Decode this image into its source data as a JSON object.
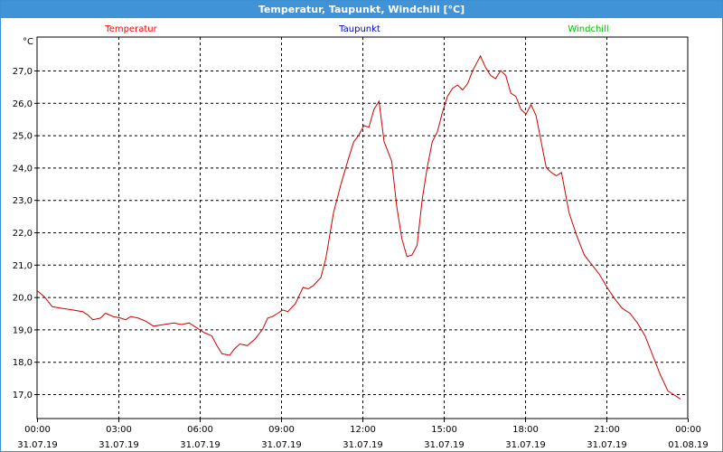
{
  "window": {
    "title": "Temperatur, Taupunkt, Windchill [°C]"
  },
  "chart_data": {
    "type": "line",
    "title": "Temperatur, Taupunkt, Windchill [°C]",
    "y_unit": "°C",
    "ylim": [
      16.6,
      28.0
    ],
    "xlim": [
      0,
      24
    ],
    "grid": true,
    "legend_placement": "top",
    "y_ticks": [
      {
        "value": 17,
        "label": "17,0"
      },
      {
        "value": 18,
        "label": "18,0"
      },
      {
        "value": 19,
        "label": "19,0"
      },
      {
        "value": 20,
        "label": "20,0"
      },
      {
        "value": 21,
        "label": "21,0"
      },
      {
        "value": 22,
        "label": "22,0"
      },
      {
        "value": 23,
        "label": "23,0"
      },
      {
        "value": 24,
        "label": "24,0"
      },
      {
        "value": 25,
        "label": "25,0"
      },
      {
        "value": 26,
        "label": "26,0"
      },
      {
        "value": 27,
        "label": "27,0"
      }
    ],
    "x_ticks": [
      {
        "hour": 0,
        "time": "00:00",
        "date": "31.07.19"
      },
      {
        "hour": 3,
        "time": "03:00",
        "date": "31.07.19"
      },
      {
        "hour": 6,
        "time": "06:00",
        "date": "31.07.19"
      },
      {
        "hour": 9,
        "time": "09:00",
        "date": "31.07.19"
      },
      {
        "hour": 12,
        "time": "12:00",
        "date": "31.07.19"
      },
      {
        "hour": 15,
        "time": "15:00",
        "date": "31.07.19"
      },
      {
        "hour": 18,
        "time": "18:00",
        "date": "31.07.19"
      },
      {
        "hour": 21,
        "time": "21:00",
        "date": "31.07.19"
      },
      {
        "hour": 24,
        "time": "00:00",
        "date": "01.08.19"
      }
    ],
    "legend": [
      {
        "name": "Temperatur",
        "color": "#ff0000"
      },
      {
        "name": "Taupunkt",
        "color": "#0000cc"
      },
      {
        "name": "Windchill",
        "color": "#00bb00"
      }
    ],
    "series": [
      {
        "name": "Temperatur",
        "color": "#cc0000",
        "points": [
          [
            0.0,
            20.2
          ],
          [
            0.3,
            20.0
          ],
          [
            0.6,
            19.7
          ],
          [
            1.0,
            19.65
          ],
          [
            1.4,
            19.6
          ],
          [
            1.8,
            19.55
          ],
          [
            2.0,
            19.45
          ],
          [
            2.2,
            19.3
          ],
          [
            2.5,
            19.35
          ],
          [
            2.7,
            19.5
          ],
          [
            3.0,
            19.4
          ],
          [
            3.3,
            19.35
          ],
          [
            3.5,
            19.3
          ],
          [
            3.7,
            19.4
          ],
          [
            4.0,
            19.35
          ],
          [
            4.3,
            19.25
          ],
          [
            4.6,
            19.1
          ],
          [
            5.0,
            19.15
          ],
          [
            5.4,
            19.2
          ],
          [
            5.7,
            19.15
          ],
          [
            6.0,
            19.2
          ],
          [
            6.3,
            19.05
          ],
          [
            6.6,
            18.9
          ],
          [
            6.9,
            18.8
          ],
          [
            7.1,
            18.5
          ],
          [
            7.3,
            18.25
          ],
          [
            7.6,
            18.2
          ],
          [
            7.8,
            18.4
          ],
          [
            8.0,
            18.55
          ],
          [
            8.3,
            18.5
          ],
          [
            8.6,
            18.7
          ],
          [
            8.9,
            19.0
          ],
          [
            9.1,
            19.35
          ],
          [
            9.3,
            19.4
          ],
          [
            9.5,
            19.5
          ],
          [
            9.7,
            19.6
          ],
          [
            9.9,
            19.55
          ],
          [
            10.2,
            19.8
          ],
          [
            10.5,
            20.3
          ],
          [
            10.7,
            20.25
          ],
          [
            10.9,
            20.35
          ],
          [
            11.2,
            20.6
          ],
          [
            11.4,
            21.2
          ],
          [
            11.7,
            22.6
          ],
          [
            12.0,
            23.5
          ],
          [
            12.3,
            24.3
          ],
          [
            12.5,
            24.8
          ],
          [
            12.7,
            25.0
          ],
          [
            12.9,
            25.3
          ],
          [
            13.1,
            25.25
          ],
          [
            13.3,
            25.8
          ],
          [
            13.5,
            26.05
          ],
          [
            13.7,
            24.8
          ],
          [
            13.9,
            24.4
          ],
          [
            14.0,
            24.2
          ],
          [
            14.2,
            22.8
          ],
          [
            14.4,
            21.8
          ],
          [
            14.6,
            21.25
          ],
          [
            14.8,
            21.3
          ],
          [
            15.0,
            21.6
          ],
          [
            15.2,
            23.0
          ],
          [
            15.4,
            24.0
          ],
          [
            15.6,
            24.8
          ],
          [
            15.8,
            25.1
          ],
          [
            16.0,
            25.7
          ],
          [
            16.2,
            26.2
          ],
          [
            16.4,
            26.45
          ],
          [
            16.6,
            26.55
          ],
          [
            16.8,
            26.4
          ],
          [
            17.0,
            26.6
          ],
          [
            17.2,
            27.0
          ],
          [
            17.4,
            27.3
          ],
          [
            17.5,
            27.45
          ],
          [
            17.7,
            27.1
          ],
          [
            17.9,
            26.85
          ],
          [
            18.1,
            26.75
          ],
          [
            18.3,
            27.0
          ],
          [
            18.5,
            26.85
          ],
          [
            18.7,
            26.3
          ],
          [
            18.9,
            26.2
          ],
          [
            19.1,
            25.8
          ],
          [
            19.3,
            25.65
          ],
          [
            19.5,
            25.95
          ],
          [
            19.7,
            25.6
          ],
          [
            19.9,
            24.8
          ],
          [
            20.1,
            24.0
          ],
          [
            20.3,
            23.85
          ],
          [
            20.5,
            23.75
          ],
          [
            20.7,
            23.85
          ],
          [
            21.0,
            22.6
          ],
          [
            21.3,
            21.9
          ],
          [
            21.6,
            21.3
          ],
          [
            21.9,
            21.0
          ],
          [
            22.2,
            20.7
          ],
          [
            22.5,
            20.3
          ],
          [
            22.8,
            19.95
          ],
          [
            23.1,
            19.65
          ],
          [
            23.4,
            19.5
          ],
          [
            23.7,
            19.2
          ],
          [
            24.0,
            18.8
          ],
          [
            24.3,
            18.2
          ],
          [
            24.6,
            17.6
          ],
          [
            24.9,
            17.1
          ],
          [
            25.2,
            16.95
          ],
          [
            25.4,
            16.85
          ]
        ]
      }
    ]
  }
}
